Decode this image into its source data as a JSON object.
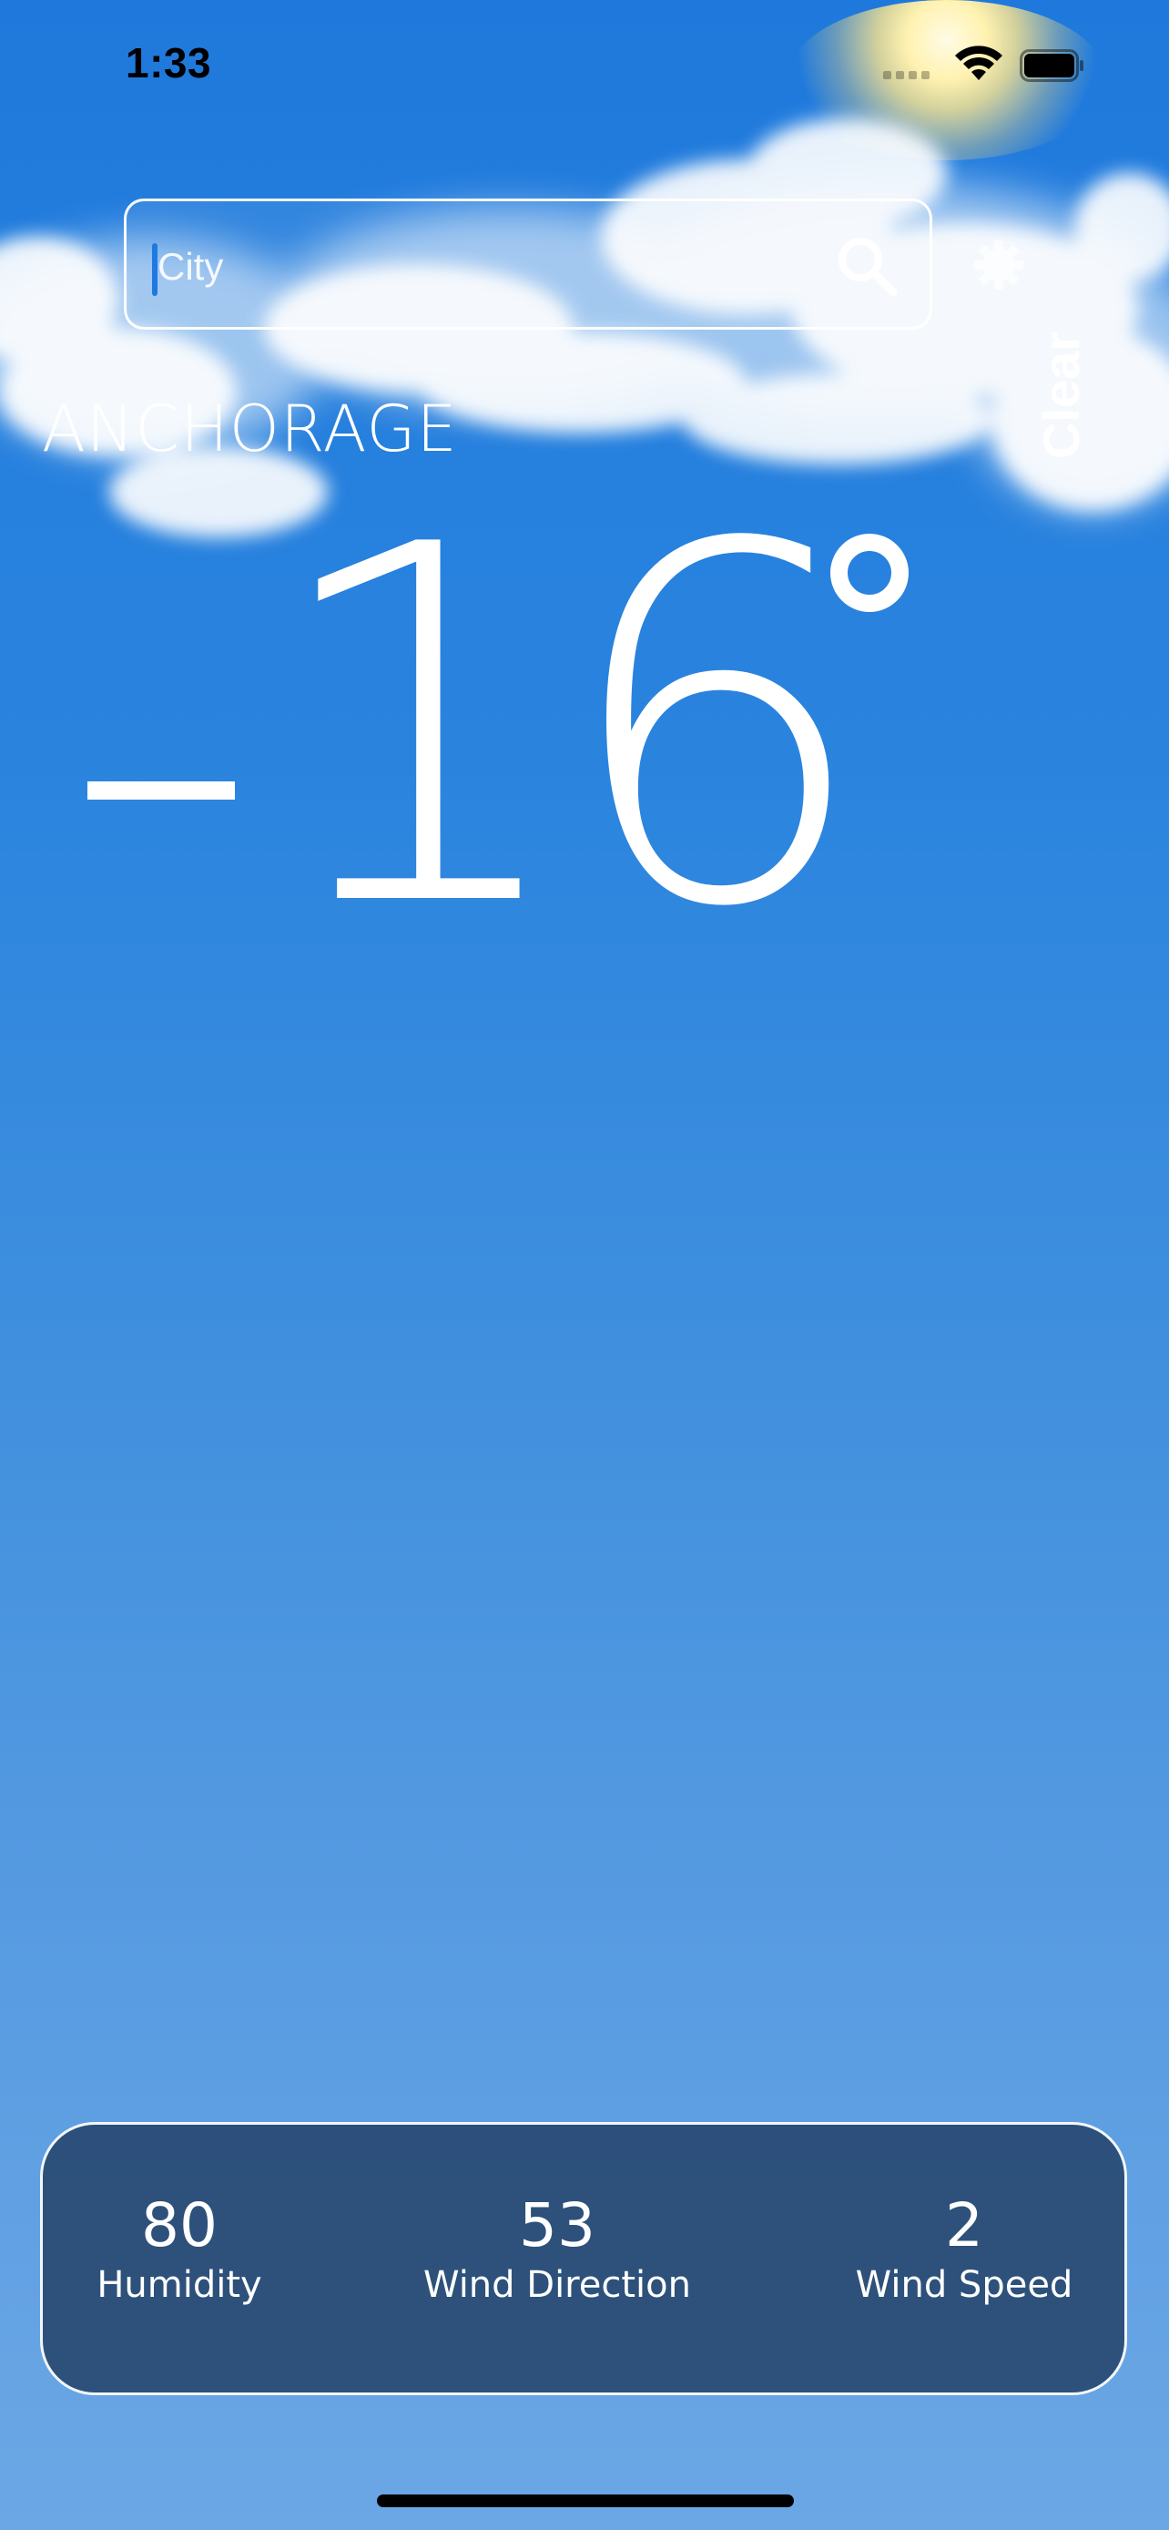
{
  "status_bar": {
    "time": "1:33",
    "signal_icon": "cellular-signal-icon",
    "wifi_icon": "wifi-icon",
    "battery_icon": "battery-icon"
  },
  "search": {
    "placeholder": "City",
    "value": "",
    "search_icon": "magnifying-glass-icon",
    "settings_icon": "gear-icon"
  },
  "weather": {
    "city": "ANCHORAGE",
    "condition": "Clear",
    "temperature": "16",
    "temperature_sign": "−",
    "unit_symbol": "°"
  },
  "stats": [
    {
      "value": "80",
      "label": "Humidity"
    },
    {
      "value": "53",
      "label": "Wind Direction"
    },
    {
      "value": "2",
      "label": "Wind Speed"
    }
  ],
  "colors": {
    "sky_top": "#1f79dc",
    "sky_bottom": "#6ba7e5",
    "card_background": "#26456c",
    "caret": "#1e7ae0",
    "text": "#ffffff"
  }
}
